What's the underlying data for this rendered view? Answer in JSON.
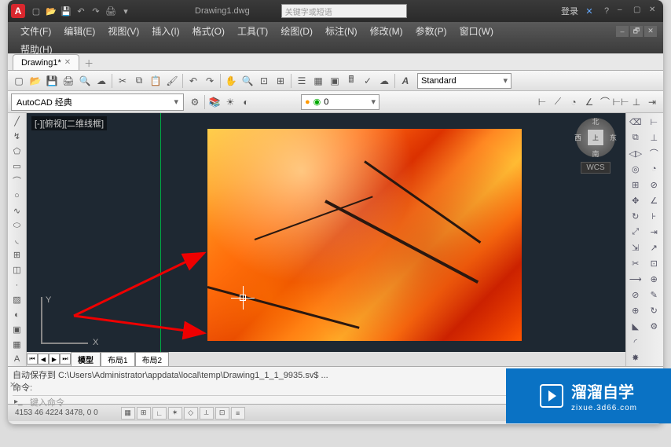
{
  "titlebar": {
    "filename": "Drawing1.dwg",
    "search_placeholder": "关键字或短语",
    "login": "登录"
  },
  "menus": [
    "文件(F)",
    "编辑(E)",
    "视图(V)",
    "插入(I)",
    "格式(O)",
    "工具(T)",
    "绘图(D)",
    "标注(N)",
    "修改(M)",
    "参数(P)",
    "窗口(W)",
    "帮助(H)"
  ],
  "tab": {
    "label": "Drawing1*"
  },
  "style_selector": "Standard",
  "workspace": "AutoCAD 经典",
  "layer": {
    "name": "0"
  },
  "canvas": {
    "view_label": "[-][俯视][二维线框]"
  },
  "ucs": {
    "x": "X",
    "y": "Y"
  },
  "viewcube": {
    "top": "北",
    "right": "东",
    "bottom": "南",
    "left": "西",
    "face": "上",
    "wcs": "WCS"
  },
  "layout_tabs": [
    "模型",
    "布局1",
    "布局2"
  ],
  "cmd": {
    "line1": "自动保存到 C:\\Users\\Administrator\\appdata\\local\\temp\\Drawing1_1_1_9935.sv$ ...",
    "line2": "命令:",
    "prompt": "键入命令"
  },
  "status": {
    "coords": "4153  46  4224  3478, 0 0"
  },
  "watermark": {
    "name": "溜溜自学",
    "url": "zixue.3d66.com"
  }
}
